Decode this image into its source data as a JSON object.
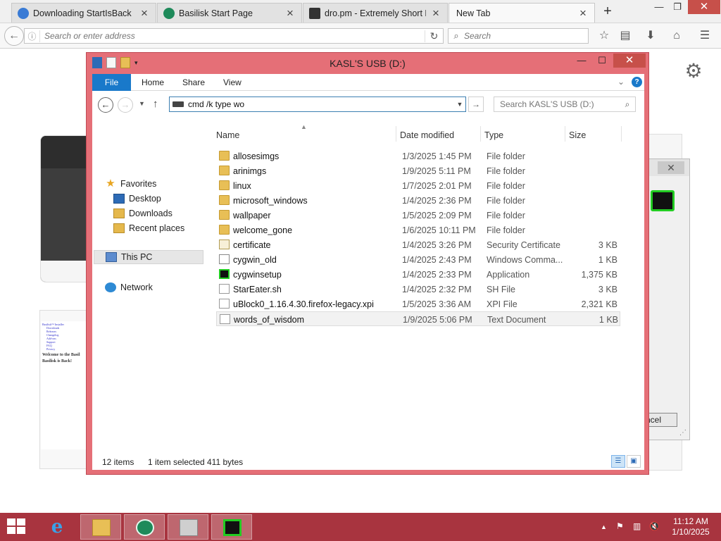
{
  "browser": {
    "tabs": [
      {
        "title": "Downloading StartIsBack 1...",
        "active": false
      },
      {
        "title": "Basilisk Start Page",
        "active": false
      },
      {
        "title": "dro.pm - Extremely Short Li...",
        "active": false
      },
      {
        "title": "New Tab",
        "active": true
      }
    ],
    "url_placeholder": "Search or enter address",
    "search_placeholder": "Search"
  },
  "background_page": {
    "thumb_heading_1": "Welcome to the Basil",
    "thumb_heading_2": "Basilisk is Back!",
    "thumb_links": [
      "Basilisk™ Installer",
      "Downloads",
      "Releases",
      "Changelog",
      "Add-ons",
      "Support",
      "FAQ",
      "Privacy"
    ],
    "dialog_cancel": "ncel"
  },
  "explorer": {
    "title": "KASL'S USB (D:)",
    "ribbon": {
      "file": "File",
      "home": "Home",
      "share": "Share",
      "view": "View"
    },
    "address_value": "cmd /k type wo",
    "search_placeholder": "Search KASL'S USB (D:)",
    "nav": {
      "favorites": "Favorites",
      "desktop": "Desktop",
      "downloads": "Downloads",
      "recent": "Recent places",
      "this_pc": "This PC",
      "network": "Network"
    },
    "columns": {
      "name": "Name",
      "date": "Date modified",
      "type": "Type",
      "size": "Size"
    },
    "files": [
      {
        "name": "allosesimgs",
        "date": "1/3/2025 1:45 PM",
        "type": "File folder",
        "size": "",
        "icon": "folder-icon"
      },
      {
        "name": "arinimgs",
        "date": "1/9/2025 5:11 PM",
        "type": "File folder",
        "size": "",
        "icon": "folder-icon"
      },
      {
        "name": "linux",
        "date": "1/7/2025 2:01 PM",
        "type": "File folder",
        "size": "",
        "icon": "folder-icon"
      },
      {
        "name": "microsoft_windows",
        "date": "1/4/2025 2:36 PM",
        "type": "File folder",
        "size": "",
        "icon": "folder-icon"
      },
      {
        "name": "wallpaper",
        "date": "1/5/2025 2:09 PM",
        "type": "File folder",
        "size": "",
        "icon": "folder-icon"
      },
      {
        "name": "welcome_gone",
        "date": "1/6/2025 10:11 PM",
        "type": "File folder",
        "size": "",
        "icon": "folder-icon"
      },
      {
        "name": "certificate",
        "date": "1/4/2025 3:26 PM",
        "type": "Security Certificate",
        "size": "3 KB",
        "icon": "certificate-icon"
      },
      {
        "name": "cygwin_old",
        "date": "1/4/2025 2:43 PM",
        "type": "Windows Comma...",
        "size": "1 KB",
        "icon": "command-script-icon"
      },
      {
        "name": "cygwinsetup",
        "date": "1/4/2025 2:33 PM",
        "type": "Application",
        "size": "1,375 KB",
        "icon": "cygwin-app-icon"
      },
      {
        "name": "StarEater.sh",
        "date": "1/4/2025 2:32 PM",
        "type": "SH File",
        "size": "3 KB",
        "icon": "document-icon"
      },
      {
        "name": "uBlock0_1.16.4.30.firefox-legacy.xpi",
        "date": "1/5/2025 3:36 AM",
        "type": "XPI File",
        "size": "2,321 KB",
        "icon": "document-icon"
      },
      {
        "name": "words_of_wisdom",
        "date": "1/9/2025 5:06 PM",
        "type": "Text Document",
        "size": "1 KB",
        "icon": "text-document-icon",
        "selected": true
      }
    ],
    "status": {
      "items": "12 items",
      "selection": "1 item selected",
      "bytes": "411 bytes"
    }
  },
  "taskbar": {
    "time": "11:12 AM",
    "date": "1/10/2025",
    "accent": "#a8343f"
  },
  "colors": {
    "window_frame": "#e56f77",
    "file_tab": "#1979ca"
  }
}
